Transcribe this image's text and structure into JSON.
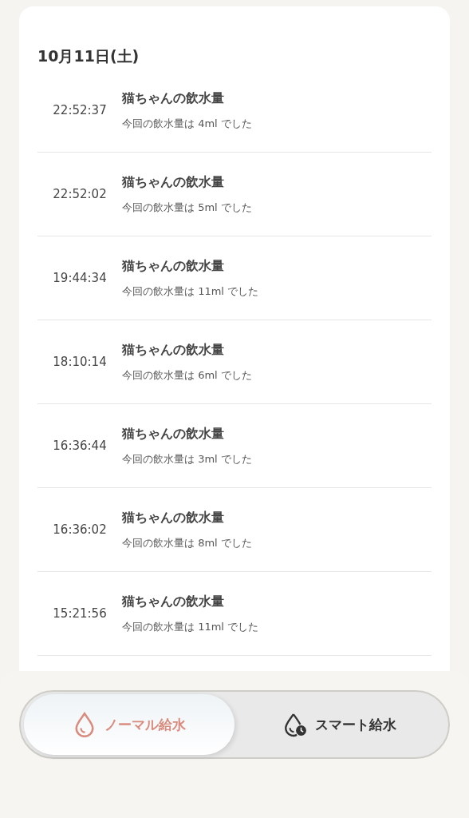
{
  "date_header": "10月11日(土)",
  "records": [
    {
      "time": "22:52:37",
      "title": "猫ちゃんの飲水量",
      "detail": "今回の飲水量は 4ml でした"
    },
    {
      "time": "22:52:02",
      "title": "猫ちゃんの飲水量",
      "detail": "今回の飲水量は 5ml でした"
    },
    {
      "time": "19:44:34",
      "title": "猫ちゃんの飲水量",
      "detail": "今回の飲水量は 11ml でした"
    },
    {
      "time": "18:10:14",
      "title": "猫ちゃんの飲水量",
      "detail": "今回の飲水量は 6ml でした"
    },
    {
      "time": "16:36:44",
      "title": "猫ちゃんの飲水量",
      "detail": "今回の飲水量は 3ml でした"
    },
    {
      "time": "16:36:02",
      "title": "猫ちゃんの飲水量",
      "detail": "今回の飲水量は 8ml でした"
    },
    {
      "time": "15:21:56",
      "title": "猫ちゃんの飲水量",
      "detail": "今回の飲水量は 11ml でした"
    }
  ],
  "mode_toggle": [
    {
      "label": "ノーマル給水",
      "kind": "normal",
      "selected": true
    },
    {
      "label": "スマート給水",
      "kind": "smart",
      "selected": false
    }
  ]
}
